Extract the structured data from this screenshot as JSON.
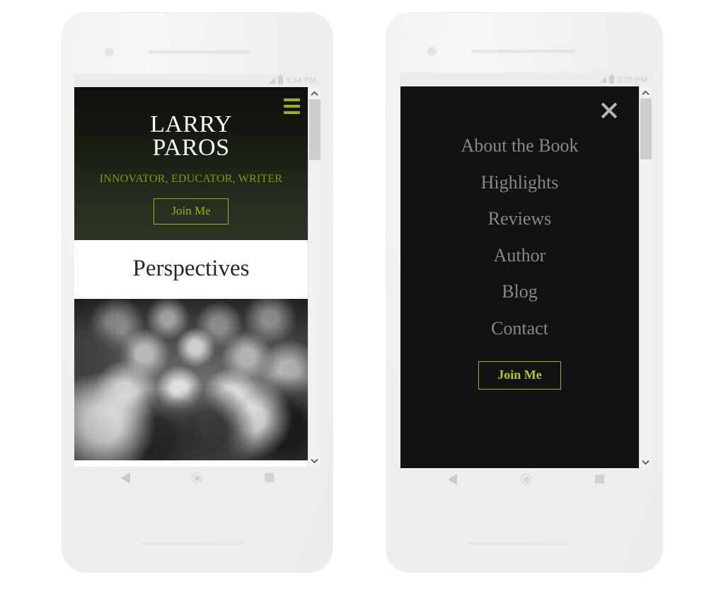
{
  "colors": {
    "accent_green": "#9bb117",
    "tagline_green": "#7f9a0e",
    "menu_join_green": "#b5c914",
    "menu_link_gray": "#8b8782",
    "hero_dark": "#0d0f0c",
    "hero_olive": "#2d3425",
    "overlay_black": "#121212",
    "section_text": "#23262b",
    "phone_body": "#f0f0f0"
  },
  "phones": [
    {
      "id": "phone-home",
      "status_bar": {
        "time": "3:34 PM",
        "signal_icon": "signal-bars-icon",
        "battery_icon": "battery-icon"
      },
      "page": {
        "hero": {
          "menu_icon": "hamburger-icon",
          "title_line1": "LARRY",
          "title_line2": "PAROS",
          "tagline": "INNOVATOR, EDUCATOR, WRITER",
          "join_label": "Join Me"
        },
        "section": {
          "heading": "Perspectives"
        },
        "photo": {
          "alt": "Black and white vintage photograph of a large seated audience crowd"
        }
      },
      "scrollbar": {
        "up_icon": "chevron-up-icon",
        "down_icon": "chevron-down-icon",
        "thumb_position": "top"
      },
      "nav_bar": {
        "back_icon": "back-triangle-icon",
        "home_icon": "home-circle-icon",
        "recents_icon": "recents-square-icon"
      }
    },
    {
      "id": "phone-menu",
      "status_bar": {
        "time": "3:35 PM",
        "signal_icon": "signal-bars-icon",
        "battery_icon": "battery-icon"
      },
      "page": {
        "overlay_menu": {
          "close_icon": "close-x-icon",
          "items": [
            {
              "label": "About the Book"
            },
            {
              "label": "Highlights"
            },
            {
              "label": "Reviews"
            },
            {
              "label": "Author"
            },
            {
              "label": "Blog"
            },
            {
              "label": "Contact"
            }
          ],
          "join_label": "Join Me"
        }
      },
      "scrollbar": {
        "up_icon": "chevron-up-icon",
        "down_icon": "chevron-down-icon",
        "thumb_position": "top"
      },
      "nav_bar": {
        "back_icon": "back-triangle-icon",
        "home_icon": "home-circle-icon",
        "recents_icon": "recents-square-icon"
      }
    }
  ]
}
